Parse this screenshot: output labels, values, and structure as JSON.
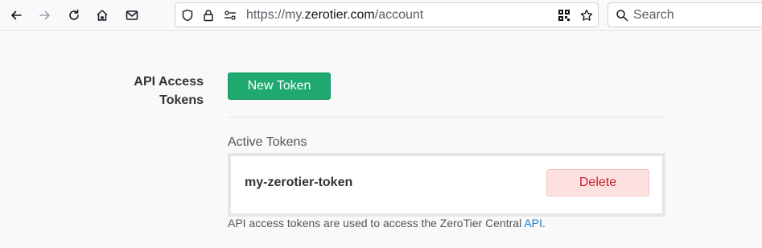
{
  "browser": {
    "url_prefix": "https://my.",
    "url_domain": "zerotier.com",
    "url_path": "/account",
    "search_placeholder": "Search"
  },
  "account": {
    "section_label_line1": "API Access",
    "section_label_line2": "Tokens",
    "new_token_label": "New Token",
    "active_tokens_label": "Active Tokens",
    "tokens": [
      {
        "name": "my-zerotier-token",
        "delete_label": "Delete"
      }
    ],
    "help_text": "API access tokens are used to access the ZeroTier Central ",
    "help_link": "API",
    "help_suffix": "."
  },
  "colors": {
    "accent": "#1fa971",
    "delete_bg": "#fde0e0",
    "delete_text": "#c8202e",
    "link": "#1a7bd1"
  },
  "icons": [
    "back-arrow-icon",
    "forward-arrow-icon",
    "reload-icon",
    "home-icon",
    "mail-icon",
    "shield-icon",
    "lock-icon",
    "permissions-icon",
    "qr-code-icon",
    "bookmark-star-icon",
    "search-icon"
  ]
}
